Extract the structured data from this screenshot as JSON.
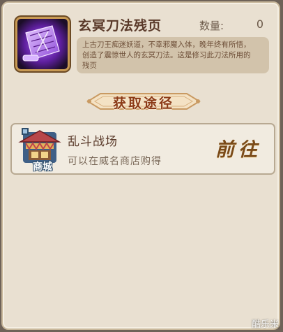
{
  "item": {
    "name": "玄冥刀法残页",
    "quantity_label": "数量:",
    "quantity_value": "0",
    "description_lines": [
      "上古刀王痴迷妖道，不幸邪魔入体，晚年终有所悟，",
      "创造了震惊世人的玄冥刀法。这是修习此刀法所用的",
      "残页"
    ],
    "icon": "purple-scroll-icon"
  },
  "acquire": {
    "title": "获取途径"
  },
  "sources": [
    {
      "title": "乱斗战场",
      "description": "可以在威名商店购得",
      "icon": "shop-icon",
      "icon_label": "商城",
      "go_label": "前往"
    }
  ],
  "watermark": "酷乐米",
  "colors": {
    "panel_bg": "#e9e0d1",
    "desc_bg": "#d2c3ab",
    "title_text": "#5a3a2a",
    "section_title": "#8b3a16",
    "go_text": "#7a4a18"
  }
}
